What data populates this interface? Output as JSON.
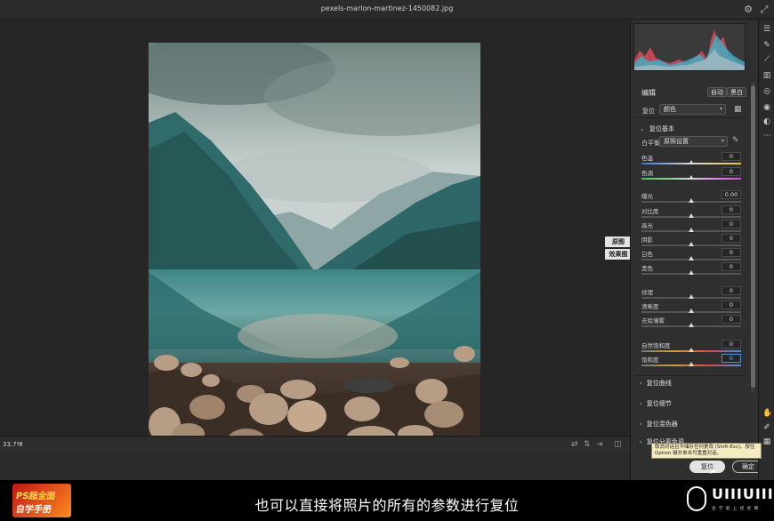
{
  "window": {
    "title": "pexels-marlon-martinez-1450082.jpg"
  },
  "canvas": {
    "zoom": "33.7%",
    "before_label": "原图",
    "after_label": "效果图"
  },
  "panel": {
    "edit_title": "编辑",
    "auto_label": "自动",
    "bw_label": "黑白",
    "profile_label": "复位",
    "profile_value": "颜色",
    "basic_title": "复位基本",
    "wb_label": "白平衡",
    "wb_value": "原照设置",
    "sliders": [
      {
        "label": "色温",
        "value": "0",
        "pos": 0.5
      },
      {
        "label": "色调",
        "value": "0",
        "pos": 0.5
      },
      {
        "label": "曝光",
        "value": "0.00",
        "pos": 0.5
      },
      {
        "label": "对比度",
        "value": "0",
        "pos": 0.5
      },
      {
        "label": "高光",
        "value": "0",
        "pos": 0.5
      },
      {
        "label": "阴影",
        "value": "0",
        "pos": 0.5
      },
      {
        "label": "白色",
        "value": "0",
        "pos": 0.5
      },
      {
        "label": "黑色",
        "value": "0",
        "pos": 0.5
      },
      {
        "label": "纹理",
        "value": "0",
        "pos": 0.5
      },
      {
        "label": "清晰度",
        "value": "0",
        "pos": 0.5
      },
      {
        "label": "去除薄雾",
        "value": "0",
        "pos": 0.5
      },
      {
        "label": "自然饱和度",
        "value": "0",
        "pos": 0.5
      },
      {
        "label": "饱和度",
        "value": "0",
        "pos": 0.5
      }
    ],
    "sections": [
      "复位曲线",
      "复位细节",
      "复位混色器",
      "复位分离色调"
    ],
    "tooltip": "取消对话且不储存任何更改 (Shift-Esc)。按住 Option 键并单击可重置对话。",
    "reset_label": "复位",
    "ok_label": "确定"
  },
  "footer": {
    "subtitle": "也可以直接将照片的所有的参数进行复位",
    "promo_line1": "PS超全面",
    "promo_line2": "自学手册",
    "brand_name": "UIIIUIII",
    "brand_tag": "含 学 就 上 优 优 网"
  },
  "colors": {
    "panel_bg": "#2f2f2f",
    "canvas_bg": "#262626",
    "accent": "#4a8fe0",
    "tooltip_bg": "#f4ecc0"
  }
}
